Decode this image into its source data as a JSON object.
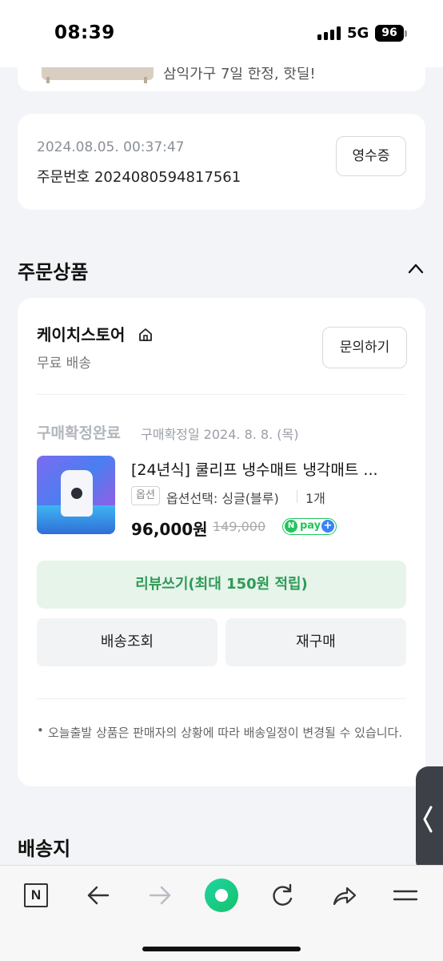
{
  "status_bar": {
    "time": "08:39",
    "network": "5G",
    "battery": "96"
  },
  "prev_item": {
    "text": "삼익가구 7일 한정, 핫딜!"
  },
  "order": {
    "datetime": "2024.08.05. 00:37:47",
    "number": "주문번호 2024080594817561",
    "receipt_label": "영수증"
  },
  "order_items": {
    "section_title": "주문상품",
    "store_name": "케이치스토어",
    "shipping_fee": "무료 배송",
    "inquiry_label": "문의하기",
    "status": "구매확정완료",
    "status_date": "구매확정일 2024. 8. 8. (목)",
    "product": {
      "title": "[24년식] 쿨리프 냉수매트 냉각매트 ...",
      "option_badge": "옵션",
      "option_text": "옵션선택: 싱글(블루)",
      "quantity": "1개",
      "price": "96,000원",
      "original_price": "149,000",
      "npay_n": "N",
      "npay_text": "pay",
      "npay_plus": "+"
    },
    "review_label": "리뷰쓰기(최대 150원 적립)",
    "track_label": "배송조회",
    "rebuy_label": "재구매",
    "notice": "오늘출발 상품은 판매자의 상황에 따라 배송일정이 변경될 수 있습니다."
  },
  "shipping": {
    "section_title": "배송지"
  },
  "bottom_nav": {
    "n_label": "N",
    "items": [
      "n-icon",
      "back-arrow-icon",
      "forward-arrow-icon",
      "green-dot-icon",
      "refresh-icon",
      "share-icon",
      "menu-icon"
    ]
  },
  "colors": {
    "accent_green": "#2f9a58",
    "review_bg": "#e6f4ea",
    "npay_green": "#22c55e"
  }
}
